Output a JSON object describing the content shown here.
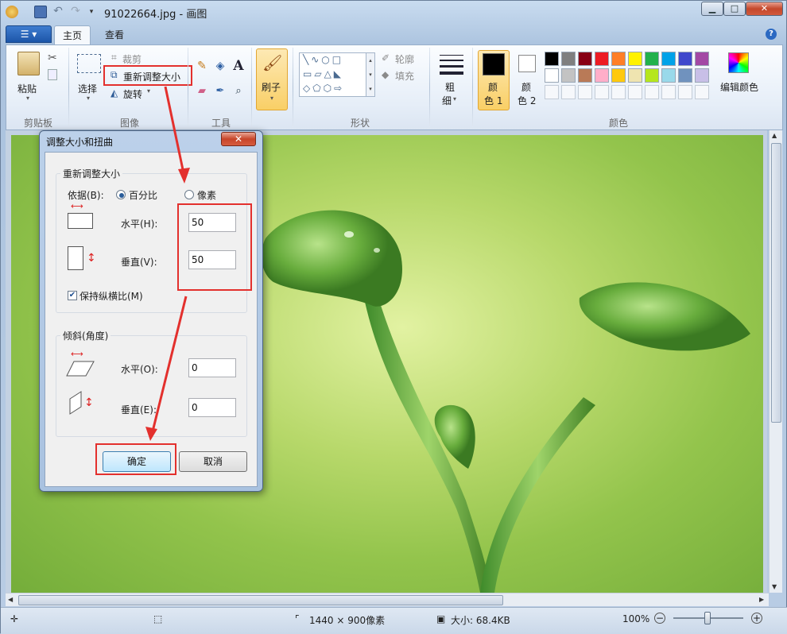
{
  "window": {
    "title": "91022664.jpg - 画图",
    "min_label": "▁",
    "max_label": "□",
    "close_label": "✕"
  },
  "tabs": {
    "home": "主页",
    "view": "查看"
  },
  "ribbon": {
    "clipboard": {
      "paste": "粘贴",
      "group": "剪贴板"
    },
    "image": {
      "select": "选择",
      "crop": "裁剪",
      "resize": "重新调整大小",
      "rotate": "旋转",
      "group": "图像"
    },
    "tools": {
      "group": "工具"
    },
    "brush": {
      "label": "刷子"
    },
    "shapes": {
      "outline": "轮廓",
      "fill": "填充",
      "group": "形状"
    },
    "size": {
      "label1": "粗",
      "label2": "细"
    },
    "colors": {
      "color1_a": "颜",
      "color1_b": "色 1",
      "color2_a": "颜",
      "color2_b": "色 2",
      "edit": "编辑颜色",
      "group": "颜色",
      "color1_value": "#000000",
      "color2_value": "#ffffff",
      "palette_row1": [
        "#000000",
        "#7f7f7f",
        "#880015",
        "#ed1c24",
        "#ff7f27",
        "#fff200",
        "#22b14c",
        "#00a2e8",
        "#3f48cc",
        "#a349a4"
      ],
      "palette_row2": [
        "#ffffff",
        "#c3c3c3",
        "#b97a57",
        "#ffaec9",
        "#ffc90e",
        "#efe4b0",
        "#b5e61d",
        "#99d9ea",
        "#7092be",
        "#c8bfe7"
      ]
    }
  },
  "dialog": {
    "title": "调整大小和扭曲",
    "resize_group": "重新调整大小",
    "by_label": "依据(B):",
    "percent": "百分比",
    "pixels": "像素",
    "horizontal_label": "水平(H):",
    "horizontal_value": "50",
    "vertical_label": "垂直(V):",
    "vertical_value": "50",
    "keep_ratio": "保持纵横比(M)",
    "skew_group": "倾斜(角度)",
    "skew_h_label": "水平(O):",
    "skew_h_value": "0",
    "skew_v_label": "垂直(E):",
    "skew_v_value": "0",
    "ok": "确定",
    "cancel": "取消",
    "close_label": "✕"
  },
  "status": {
    "dimensions": "1440 × 900像素",
    "size": "大小: 68.4KB",
    "zoom": "100%"
  },
  "colors": {
    "annotation_red": "#e3302d"
  }
}
